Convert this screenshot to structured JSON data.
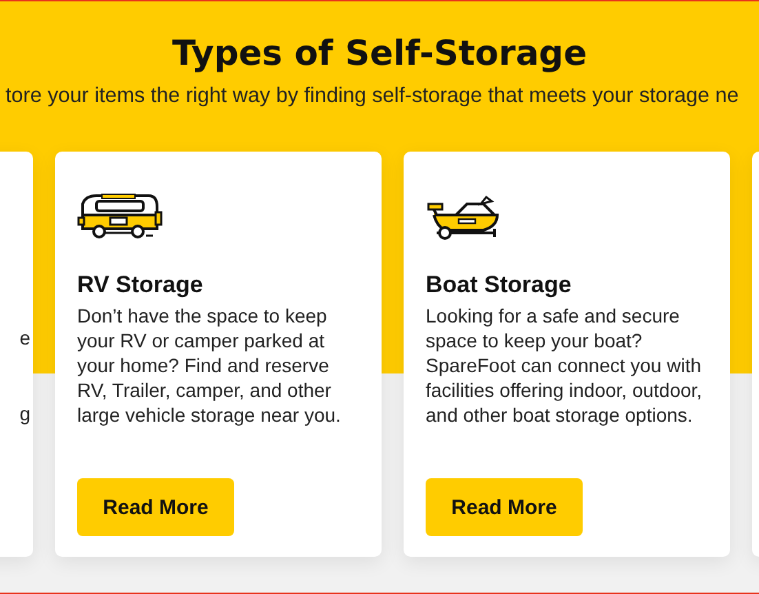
{
  "banner": {
    "title": "Types of Self-Storage",
    "subtitle": "tore your items the right way by finding self-storage that meets your storage ne"
  },
  "cards": [
    {
      "kind": "partial",
      "lines": [
        "e",
        "g"
      ]
    },
    {
      "kind": "rv",
      "title": "RV Storage",
      "text": "Don’t have the space to keep your RV or camper parked at your home? Find and reserve RV, Trailer, camper, and other large vehicle storage near you.",
      "button": "Read More"
    },
    {
      "kind": "boat",
      "title": "Boat Storage",
      "text": "Looking for a safe and secure space to keep your boat? SpareFoot can connect you with facilities offering indoor, outdoor, and other boat storage options.",
      "button": "Read More"
    },
    {
      "kind": "edge"
    }
  ]
}
